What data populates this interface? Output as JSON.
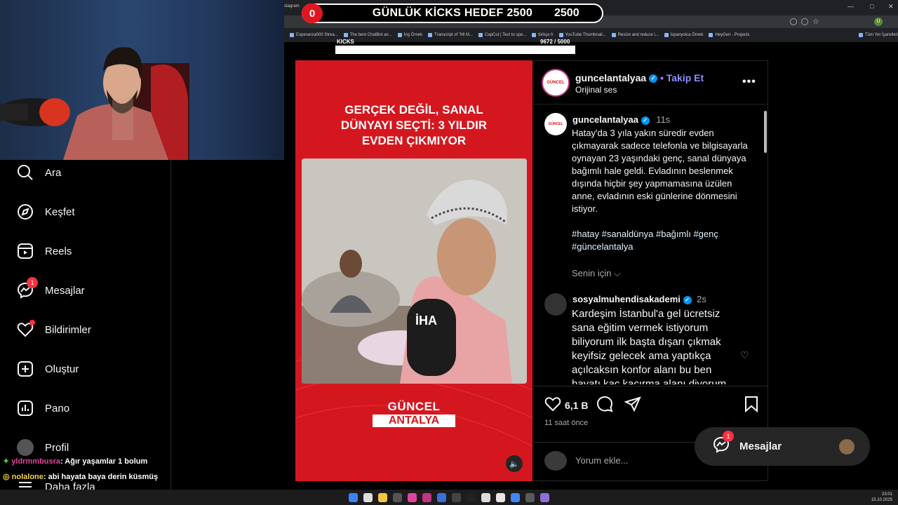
{
  "browser": {
    "tab_title": "stagram",
    "bookmarks": [
      "Esperanza000 Strea...",
      "The best ChatBot an...",
      "İng Örnek",
      "Transcript of \"Mi M...",
      "CapCut | Text to spe...",
      "türkçe h",
      "YouTube Thumbnail...",
      "Resize and reduce i...",
      "İspanyolca Örnek",
      "HeyGen - Projects",
      "Tüm Yer İşaretleri"
    ]
  },
  "goal": {
    "count": "0",
    "title": "GÜNLÜK KİCKS HEDEF 2500",
    "value": "2500",
    "kicks_label": "KICKS",
    "kicks_count": "9672  / 5000",
    "progress": 1.0
  },
  "nav": {
    "items": [
      {
        "label": "Ara",
        "icon": "search-icon"
      },
      {
        "label": "Keşfet",
        "icon": "compass-icon"
      },
      {
        "label": "Reels",
        "icon": "reels-icon"
      },
      {
        "label": "Mesajlar",
        "icon": "messenger-icon",
        "badge": "1"
      },
      {
        "label": "Bildirimler",
        "icon": "heart-icon"
      },
      {
        "label": "Oluştur",
        "icon": "plus-square-icon"
      },
      {
        "label": "Pano",
        "icon": "dashboard-icon"
      },
      {
        "label": "Profil",
        "icon": "avatar"
      },
      {
        "label": "Daha fazla",
        "icon": "menu-icon"
      }
    ]
  },
  "chat": [
    {
      "user": "yldrmmbusra",
      "text": ": Ağır yaşamlar 1 bolum"
    },
    {
      "user": "nolalone",
      "text": ": abi hayata baya derin küsmüş"
    }
  ],
  "post": {
    "headline": [
      "GERÇEK DEĞİL, SANAL",
      "DÜNYAYI SEÇTİ: 3 YILDIR",
      "EVDEN ÇIKMIYOR"
    ],
    "logo_line1": "GÜNCEL",
    "logo_line2": "ANTALYA",
    "watermark": "İHA",
    "author": "guncelantalyaa",
    "follow": "• Takip Et",
    "audio": "Orijinal ses",
    "caption_author": "guncelantalyaa",
    "caption_time": "11s",
    "caption": "Hatay'da 3 yıla yakın süredir evden çıkmayarak sadece telefonla ve bilgisayarla oynayan 23 yaşındaki genç, sanal dünyaya bağımlı hale geldi. Evladının beslenmek dışında hiçbir şey yapmamasına üzülen anne, evladının eski günlerine dönmesini istiyor.",
    "hashtags": "#hatay #sanaldünya #bağımlı #genç #güncelantalya",
    "for_you": "Senin için",
    "comment_author": "sosyalmuhendisakademi",
    "comment_time": "2s",
    "comment_text": "Kardeşim İstanbul'a gel ücretsiz sana eğitim vermek istiyorum biliyorum ilk başta dışarı çıkmak keyifsiz gelecek ama yaptıkça açılcaksın konfor alanı bu ben hayatı kaç kaçırma alanı diyorum",
    "likes": "6,1 B",
    "posted": "11 saat önce",
    "comment_placeholder": "Yorum ekle..."
  },
  "messages_pill": {
    "label": "Mesajlar",
    "badge": "1"
  },
  "clock": {
    "time": "23:01",
    "date": "15.10.2025"
  },
  "colors": {
    "brand_red": "#d4171f",
    "accent_blue": "#0095f6",
    "link": "#e0f1ff",
    "follow": "#8e8eff"
  }
}
